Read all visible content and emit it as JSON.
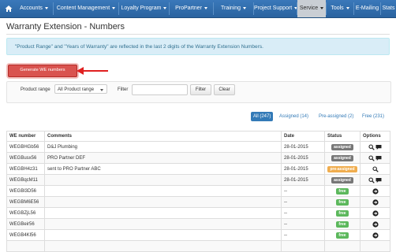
{
  "nav": {
    "items": [
      {
        "label": "Accounts",
        "caret": true
      },
      {
        "label": "Content Management",
        "caret": true
      },
      {
        "label": "Loyalty Program",
        "caret": true
      },
      {
        "label": "ProPartner",
        "caret": true
      },
      {
        "label": "Training",
        "caret": true
      },
      {
        "label": "Project Support",
        "caret": true
      },
      {
        "label": "Service",
        "caret": true,
        "active": true
      },
      {
        "label": "Tools",
        "caret": true
      },
      {
        "label": "E-Mailing",
        "caret": false
      },
      {
        "label": "Stats",
        "caret": false
      }
    ]
  },
  "page": {
    "title": "Warranty Extension - Numbers",
    "info": "\"Product Range\" and \"Years of Warranty\" are reflected in the last 2 digits of the Warranty Extension Numbers.",
    "generate_label": "Generate WE numbers"
  },
  "filters": {
    "product_range_label": "Product range",
    "product_range_value": "All Product range",
    "filter_label": "Filter",
    "filter_button": "Filter",
    "clear_button": "Clear"
  },
  "tabs": [
    {
      "label": "All (247)",
      "active": true
    },
    {
      "label": "Assigned (14)",
      "active": false
    },
    {
      "label": "Pre-assigned (2)",
      "active": false
    },
    {
      "label": "Free (231)",
      "active": false
    }
  ],
  "table": {
    "headers": [
      "WE number",
      "Comments",
      "Date",
      "Status",
      "Options"
    ],
    "rows": [
      {
        "we": "WEGBHGb56",
        "comment": "D&J Plumbing",
        "date": "28-01-2015",
        "status": "assigned",
        "options": [
          "view",
          "comment"
        ]
      },
      {
        "we": "WEGBusx56",
        "comment": "PRO Partner DEF",
        "date": "28-01-2015",
        "status": "assigned",
        "options": [
          "view",
          "comment"
        ]
      },
      {
        "we": "WEGBH4z31",
        "comment": "sent to PRO Partner ABC",
        "date": "28-01-2015",
        "status": "pre-assigned",
        "options": [
          "view"
        ]
      },
      {
        "we": "WEGBqcM11",
        "comment": "",
        "date": "28-01-2015",
        "status": "assigned",
        "options": [
          "view",
          "comment"
        ]
      },
      {
        "we": "WEGBl3D56",
        "comment": "",
        "date": "--",
        "status": "free",
        "options": [
          "go"
        ]
      },
      {
        "we": "WEGBM6E56",
        "comment": "",
        "date": "--",
        "status": "free",
        "options": [
          "go"
        ]
      },
      {
        "we": "WEGBZjL56",
        "comment": "",
        "date": "--",
        "status": "free",
        "options": [
          "go"
        ]
      },
      {
        "we": "WEGBeir56",
        "comment": "",
        "date": "--",
        "status": "free",
        "options": [
          "go"
        ]
      },
      {
        "we": "WEGB4Kl56",
        "comment": "",
        "date": "--",
        "status": "free",
        "options": [
          "go"
        ]
      },
      {
        "we": "",
        "comment": "",
        "date": "",
        "status": "",
        "options": []
      }
    ]
  },
  "colors": {
    "assigned": "#777777",
    "pre-assigned": "#f0ad4e",
    "free": "#5cb85c",
    "nav": "#2f6ba8",
    "danger": "#d9534f"
  }
}
